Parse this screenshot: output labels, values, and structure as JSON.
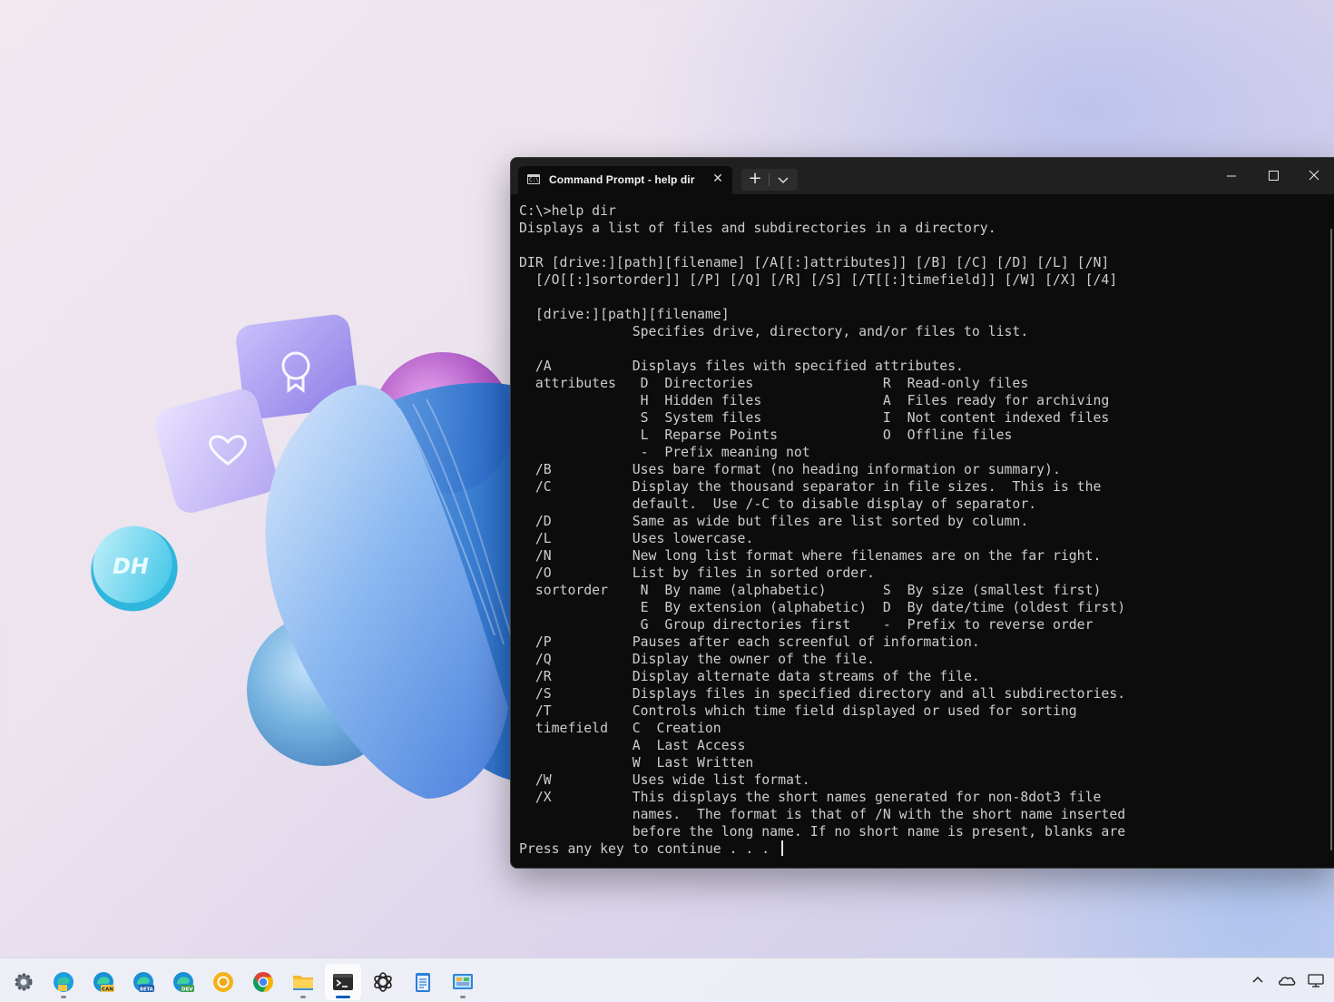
{
  "desktop": {
    "coin_text": "DH"
  },
  "window": {
    "tab_title": "Command Prompt - help  dir",
    "tab_icon_text": "C:\\",
    "tab_close": "✕",
    "new_tab": "+",
    "scrollbar": true
  },
  "console": {
    "lines": [
      "C:\\>help dir",
      "Displays a list of files and subdirectories in a directory.",
      "",
      "DIR [drive:][path][filename] [/A[[:]attributes]] [/B] [/C] [/D] [/L] [/N]",
      "  [/O[[:]sortorder]] [/P] [/Q] [/R] [/S] [/T[[:]timefield]] [/W] [/X] [/4]",
      "",
      "  [drive:][path][filename]",
      "              Specifies drive, directory, and/or files to list.",
      "",
      "  /A          Displays files with specified attributes.",
      "  attributes   D  Directories                R  Read-only files",
      "               H  Hidden files               A  Files ready for archiving",
      "               S  System files               I  Not content indexed files",
      "               L  Reparse Points             O  Offline files",
      "               -  Prefix meaning not",
      "  /B          Uses bare format (no heading information or summary).",
      "  /C          Display the thousand separator in file sizes.  This is the",
      "              default.  Use /-C to disable display of separator.",
      "  /D          Same as wide but files are list sorted by column.",
      "  /L          Uses lowercase.",
      "  /N          New long list format where filenames are on the far right.",
      "  /O          List by files in sorted order.",
      "  sortorder    N  By name (alphabetic)       S  By size (smallest first)",
      "               E  By extension (alphabetic)  D  By date/time (oldest first)",
      "               G  Group directories first    -  Prefix to reverse order",
      "  /P          Pauses after each screenful of information.",
      "  /Q          Display the owner of the file.",
      "  /R          Display alternate data streams of the file.",
      "  /S          Displays files in specified directory and all subdirectories.",
      "  /T          Controls which time field displayed or used for sorting",
      "  timefield   C  Creation",
      "              A  Last Access",
      "              W  Last Written",
      "  /W          Uses wide list format.",
      "  /X          This displays the short names generated for non-8dot3 file",
      "              names.  The format is that of /N with the short name inserted",
      "              before the long name. If no short name is present, blanks are"
    ],
    "prompt_line": "Press any key to continue . . . "
  },
  "taskbar": {
    "items": [
      {
        "icon": "settings-icon",
        "running": false
      },
      {
        "icon": "edge-canary-icon",
        "running": true
      },
      {
        "icon": "edge-can-icon",
        "badge": "CAN",
        "running": false
      },
      {
        "icon": "edge-beta-icon",
        "badge": "BETA",
        "running": false
      },
      {
        "icon": "edge-dev-icon",
        "badge": "DEV",
        "running": false
      },
      {
        "icon": "chrome-canary-icon",
        "running": false
      },
      {
        "icon": "chrome-icon",
        "running": false
      },
      {
        "icon": "file-explorer-icon",
        "running": true
      },
      {
        "icon": "terminal-icon",
        "running": true,
        "active": true
      },
      {
        "icon": "chatgpt-icon",
        "running": false
      },
      {
        "icon": "notepad-icon",
        "running": false
      },
      {
        "icon": "control-panel-icon",
        "running": true
      }
    ],
    "tray": [
      "chevron-up-icon",
      "onedrive-icon",
      "display-icon"
    ]
  },
  "colors": {
    "console_bg": "#0c0c0c",
    "console_text": "#cccccc",
    "titlebar": "#202020",
    "accent": "#005fb8"
  }
}
